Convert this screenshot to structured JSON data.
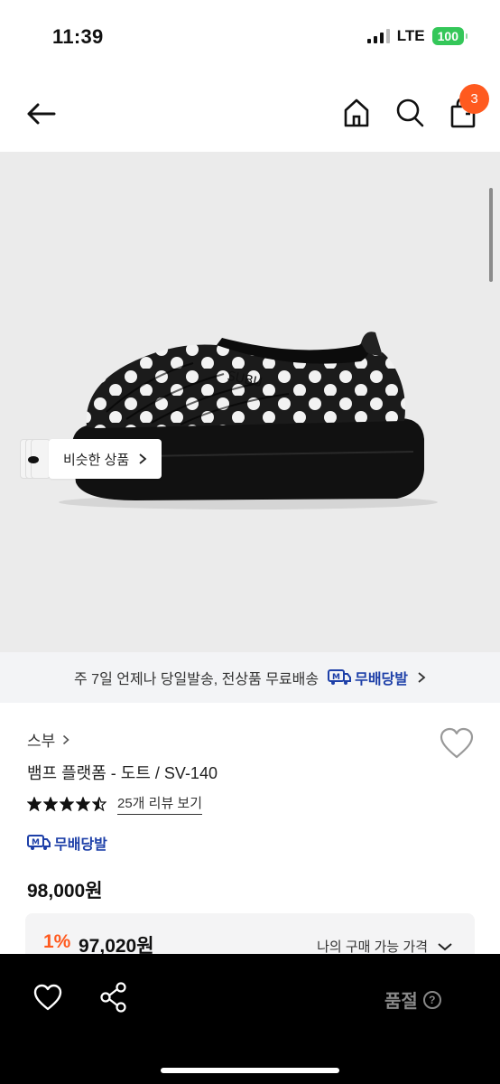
{
  "status_bar": {
    "time": "11:39",
    "network": "LTE",
    "battery": "100"
  },
  "nav": {
    "cart_count": "3"
  },
  "product_image": {
    "similar_label": "비슷한 상품"
  },
  "delivery_banner": {
    "text": "주 7일 언제나 당일발송, 전상품 무료배송",
    "badge": "무배당발"
  },
  "product": {
    "brand": "스부",
    "name": "뱀프 플랫폼 - 도트 / SV-140",
    "rating": 4.5,
    "review_link": "25개 리뷰 보기",
    "free_shipping_badge": "무배당발",
    "price": "98,000원"
  },
  "discount": {
    "rate": "1%",
    "price": "97,020원",
    "my_price_label": "나의 구매 가능 가격"
  },
  "bottom_bar": {
    "soldout_label": "품절",
    "help_glyph": "?"
  },
  "colors": {
    "accent": "#ff5a1f",
    "brand_blue": "#1d3fa8",
    "success": "#34c759"
  }
}
